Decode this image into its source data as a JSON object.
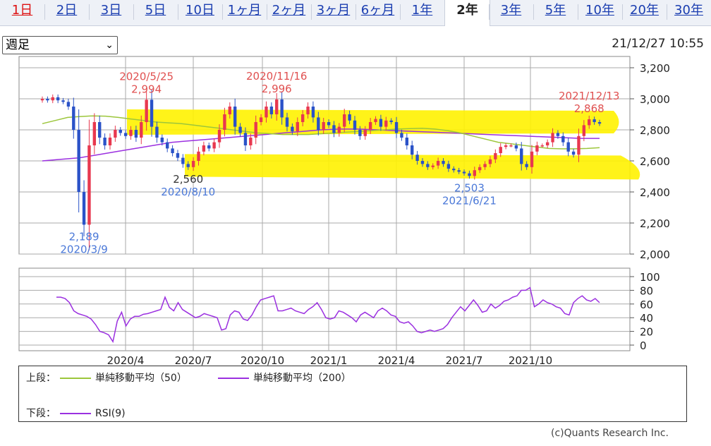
{
  "tabs": [
    {
      "label": "1日",
      "state": "red"
    },
    {
      "label": "2日"
    },
    {
      "label": "3日"
    },
    {
      "label": "5日"
    },
    {
      "label": "10日"
    },
    {
      "label": "1ヶ月"
    },
    {
      "label": "2ヶ月"
    },
    {
      "label": "3ヶ月"
    },
    {
      "label": "6ヶ月"
    },
    {
      "label": "1年"
    },
    {
      "label": "2年",
      "state": "active"
    },
    {
      "label": "3年"
    },
    {
      "label": "5年"
    },
    {
      "label": "10年"
    },
    {
      "label": "20年"
    },
    {
      "label": "30年"
    }
  ],
  "period_select": {
    "value": "週足"
  },
  "timestamp": "21/12/27 10:55",
  "colors": {
    "up": "#e8384f",
    "down": "#2a52c8",
    "sma50": "#9cc63b",
    "sma200": "#9b30e0",
    "rsi": "#9b30e0",
    "highlight": "#fff200",
    "grid": "#aaaaaa",
    "peak_label": "#e05050",
    "trough_label": "#4a78d8"
  },
  "chart_data": {
    "type": "candlestick",
    "main": {
      "y_ticks": [
        "3,200",
        "3,000",
        "2,800",
        "2,600",
        "2,400",
        "2,200",
        "2,000"
      ],
      "y_range": [
        2000,
        3200
      ],
      "close": [
        3000,
        2990,
        3010,
        2990,
        2980,
        2950,
        2800,
        2400,
        2189,
        2700,
        2850,
        2750,
        2700,
        2750,
        2800,
        2780,
        2760,
        2800,
        2750,
        2850,
        2994,
        2820,
        2750,
        2720,
        2680,
        2650,
        2620,
        2580,
        2560,
        2600,
        2660,
        2700,
        2680,
        2720,
        2800,
        2900,
        2950,
        2820,
        2780,
        2700,
        2750,
        2850,
        2880,
        2950,
        2900,
        2996,
        2880,
        2820,
        2790,
        2850,
        2900,
        2950,
        2880,
        2800,
        2850,
        2830,
        2780,
        2820,
        2900,
        2860,
        2800,
        2760,
        2800,
        2850,
        2870,
        2820,
        2860,
        2850,
        2780,
        2750,
        2700,
        2640,
        2600,
        2580,
        2560,
        2570,
        2600,
        2580,
        2550,
        2540,
        2530,
        2520,
        2503,
        2540,
        2560,
        2580,
        2610,
        2650,
        2690,
        2700,
        2700,
        2680,
        2580,
        2560,
        2660,
        2700,
        2700,
        2720,
        2780,
        2760,
        2720,
        2660,
        2640,
        2760,
        2830,
        2868,
        2850,
        2840
      ],
      "sma50": [
        2840,
        2860,
        2880,
        2886,
        2890,
        2888,
        2880,
        2870,
        2860,
        2850,
        2845,
        2840,
        2830,
        2820,
        2810,
        2800,
        2790,
        2780,
        2775,
        2770,
        2770,
        2770,
        2775,
        2780,
        2785,
        2790,
        2795,
        2800,
        2805,
        2808,
        2810,
        2805,
        2795,
        2780,
        2760,
        2740,
        2720,
        2710,
        2700,
        2690,
        2680,
        2678,
        2678,
        2680,
        2685
      ],
      "sma200": [
        2600,
        2610,
        2620,
        2640,
        2660,
        2680,
        2700,
        2720,
        2730,
        2740,
        2750,
        2760,
        2770,
        2780,
        2790,
        2800,
        2805,
        2805,
        2800,
        2795,
        2790,
        2785,
        2780,
        2775,
        2770,
        2765,
        2760,
        2755,
        2750,
        2745,
        2745
      ],
      "annotations": [
        {
          "date": "2020/5/25",
          "value": "2,994",
          "kind": "peak"
        },
        {
          "date": "2020/11/16",
          "value": "2,996",
          "kind": "peak"
        },
        {
          "date": "2021/12/13",
          "value": "2,868",
          "kind": "peak"
        },
        {
          "date": "2020/3/9",
          "value": "2,189",
          "kind": "trough"
        },
        {
          "date": "2020/8/10",
          "value": "2,560",
          "kind": "trough"
        },
        {
          "date": "2021/6/21",
          "value": "2,503",
          "kind": "trough"
        }
      ]
    },
    "rsi": {
      "y_ticks": [
        "100",
        "80",
        "60",
        "40",
        "20",
        "0"
      ],
      "y_range": [
        0,
        100
      ],
      "values": [
        70,
        70,
        68,
        62,
        50,
        46,
        44,
        42,
        38,
        30,
        20,
        18,
        15,
        5,
        35,
        48,
        28,
        38,
        42,
        42,
        45,
        46,
        48,
        50,
        52,
        70,
        55,
        50,
        62,
        52,
        48,
        44,
        40,
        42,
        46,
        44,
        42,
        40,
        22,
        24,
        44,
        50,
        48,
        38,
        36,
        44,
        56,
        66,
        68,
        70,
        72,
        50,
        50,
        52,
        54,
        50,
        48,
        46,
        52,
        56,
        62,
        52,
        40,
        38,
        40,
        50,
        48,
        44,
        40,
        34,
        44,
        48,
        44,
        40,
        50,
        54,
        50,
        44,
        42,
        34,
        32,
        34,
        28,
        20,
        18,
        20,
        22,
        20,
        22,
        24,
        30,
        40,
        48,
        56,
        50,
        58,
        66,
        58,
        48,
        50,
        60,
        54,
        58,
        64,
        66,
        70,
        72,
        80,
        80,
        84,
        56,
        60,
        66,
        62,
        60,
        56,
        54,
        46,
        44,
        62,
        68,
        72,
        66,
        64,
        68,
        62
      ]
    },
    "x_ticks": [
      "2020/4",
      "2020/7",
      "2020/10",
      "2021/1",
      "2021/4",
      "2021/7",
      "2021/10"
    ]
  },
  "legend": {
    "upper_label": "上段：",
    "sma50_label": "単純移動平均（50）",
    "sma200_label": "単純移動平均（200）",
    "lower_label": "下段：",
    "rsi_label": "RSI(9)"
  },
  "credit": "(c)Quants Research Inc."
}
